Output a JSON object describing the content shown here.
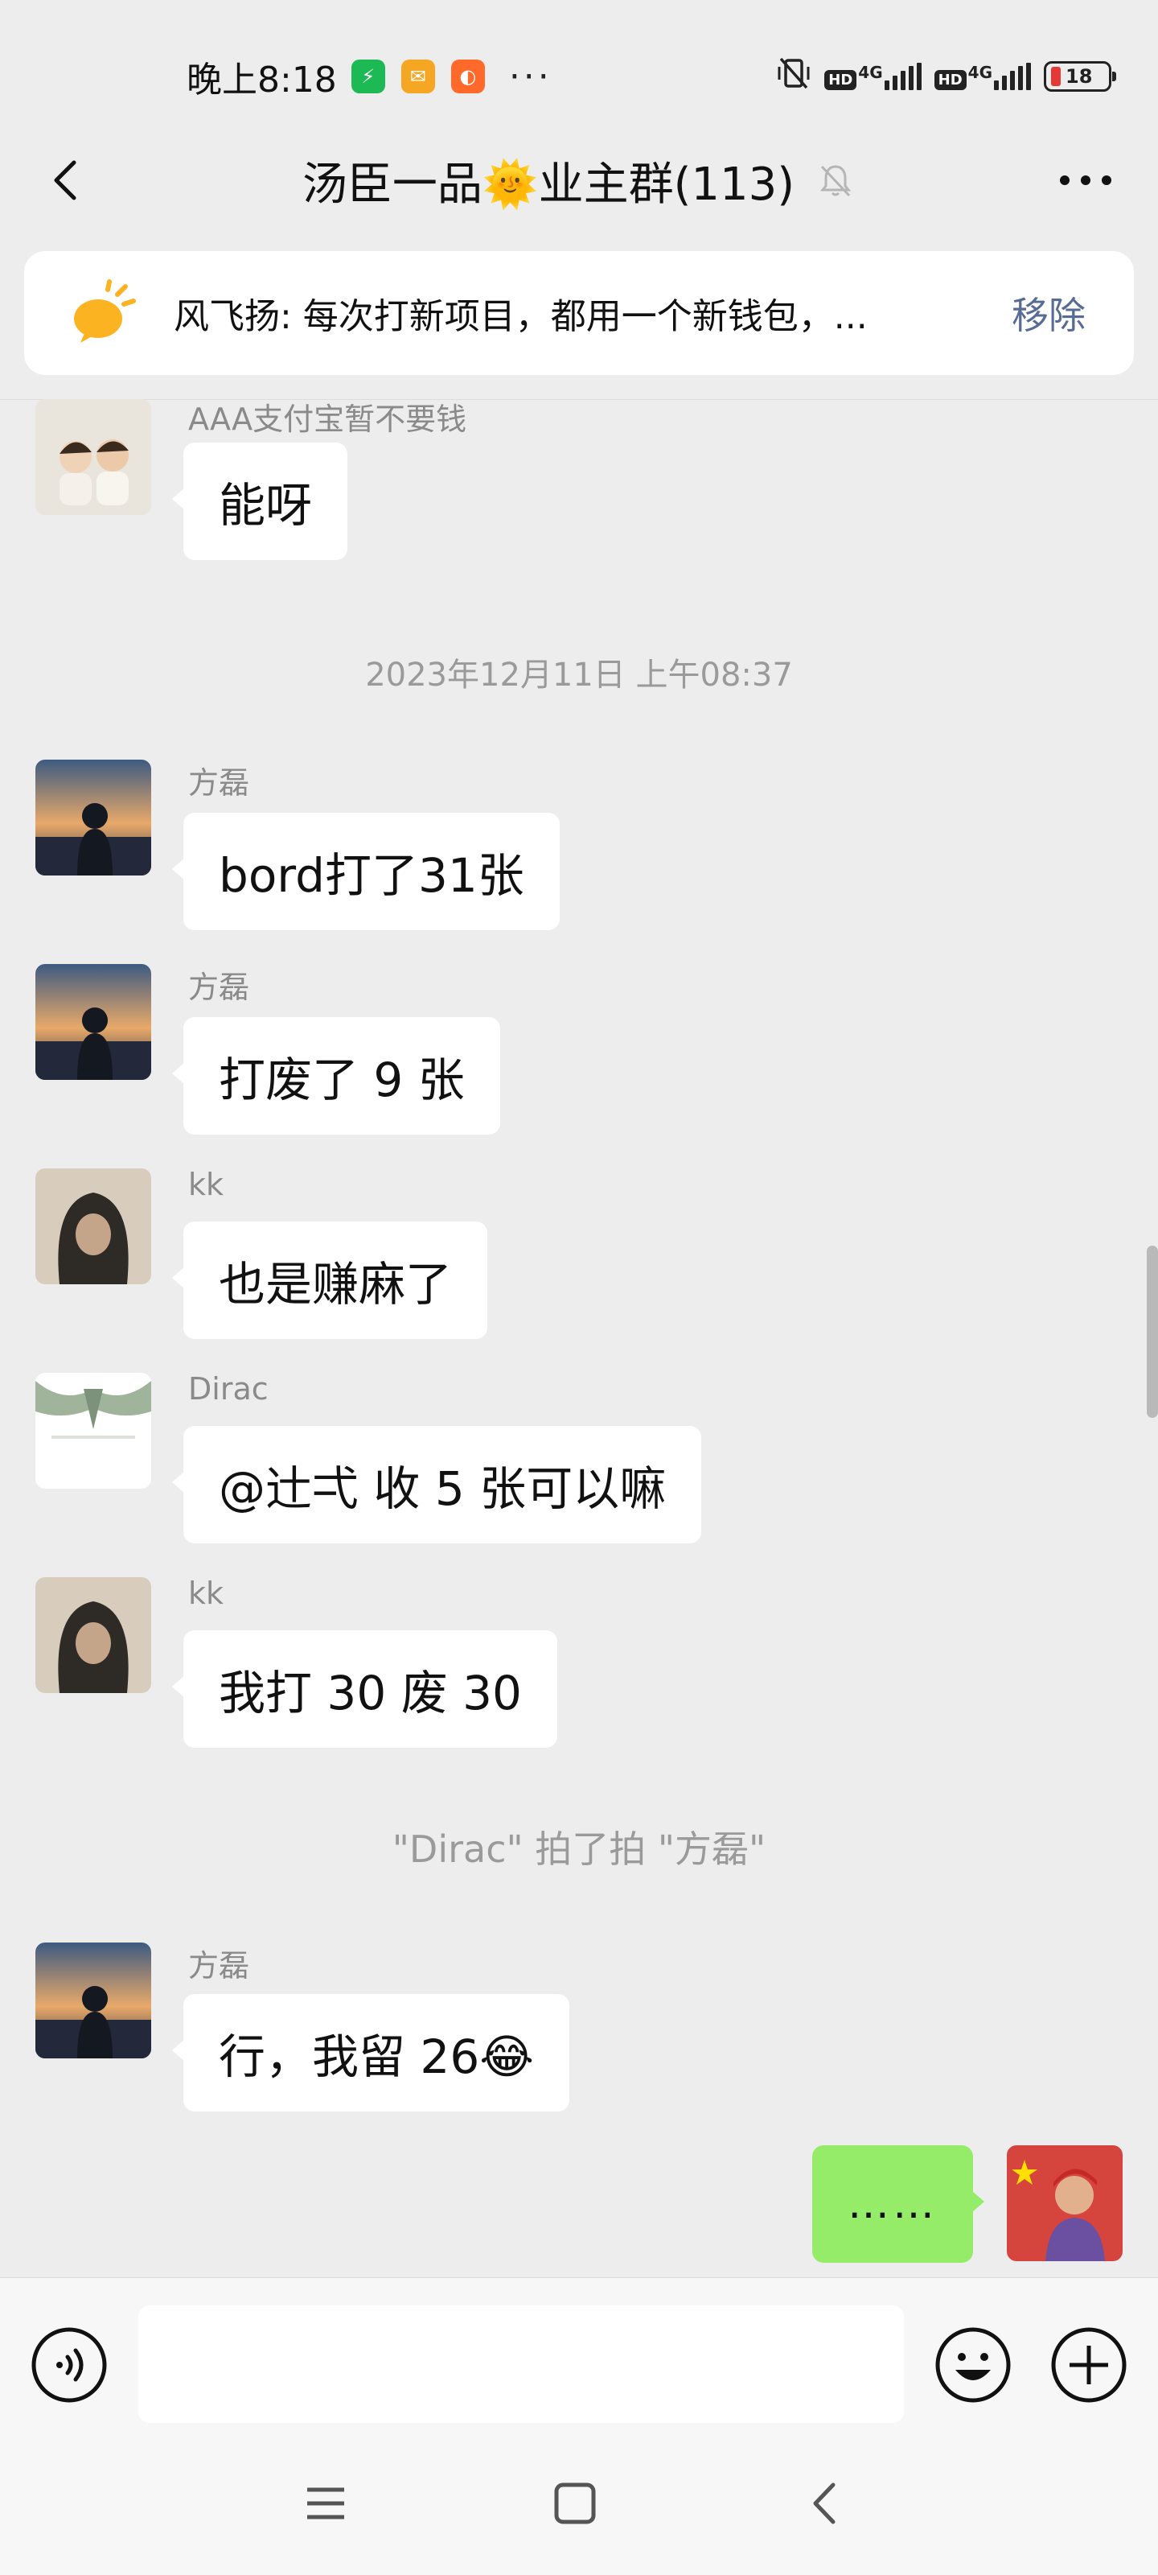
{
  "status_bar": {
    "time": "晚上8:18",
    "more": "···",
    "hd": "HD",
    "net": "4G",
    "battery": "18",
    "colors": {
      "app_green": "#1db954",
      "app_yellow": "#f5a623",
      "app_orange": "#ff6a2b",
      "battery_low": "#e53935"
    }
  },
  "header": {
    "title": "汤臣一品🌞业主群(113)",
    "back_icon": "chevron-left-icon",
    "mute_icon": "bell-off-icon",
    "more_icon": "ellipsis-icon"
  },
  "pinned": {
    "text": "风飞扬: 每次打新项目，都用一个新钱包，...",
    "remove_label": "移除",
    "icon": "megaphone-icon",
    "colors": {
      "icon": "#fbb321",
      "link": "#576b95"
    }
  },
  "messages": [
    {
      "sender": "AAA支付宝暂不要钱",
      "text": "能呀"
    },
    {
      "timestamp": "2023年12月11日 上午08:37"
    },
    {
      "sender": "方磊",
      "text": "bord打了31张"
    },
    {
      "sender": "方磊",
      "text": "打废了 9 张"
    },
    {
      "sender": "kk",
      "text": "也是赚麻了"
    },
    {
      "sender": "Dirac",
      "text": "@辻弌  收 5 张可以嘛"
    },
    {
      "sender": "kk",
      "text": "我打 30 废 30"
    },
    {
      "system": "\"Dirac\" 拍了拍 \"方磊\""
    },
    {
      "sender": "方磊",
      "text": "行，我留 26😂"
    },
    {
      "self": true,
      "text": "……"
    }
  ],
  "input_bar": {
    "placeholder": "",
    "voice_icon": "voice-icon",
    "emoji_icon": "emoji-icon",
    "plus_icon": "plus-icon",
    "colors": {
      "my_bubble": "#95ec69"
    }
  },
  "system_nav": {
    "menu_icon": "menu-icon",
    "home_icon": "home-icon",
    "back_icon": "back-icon"
  }
}
